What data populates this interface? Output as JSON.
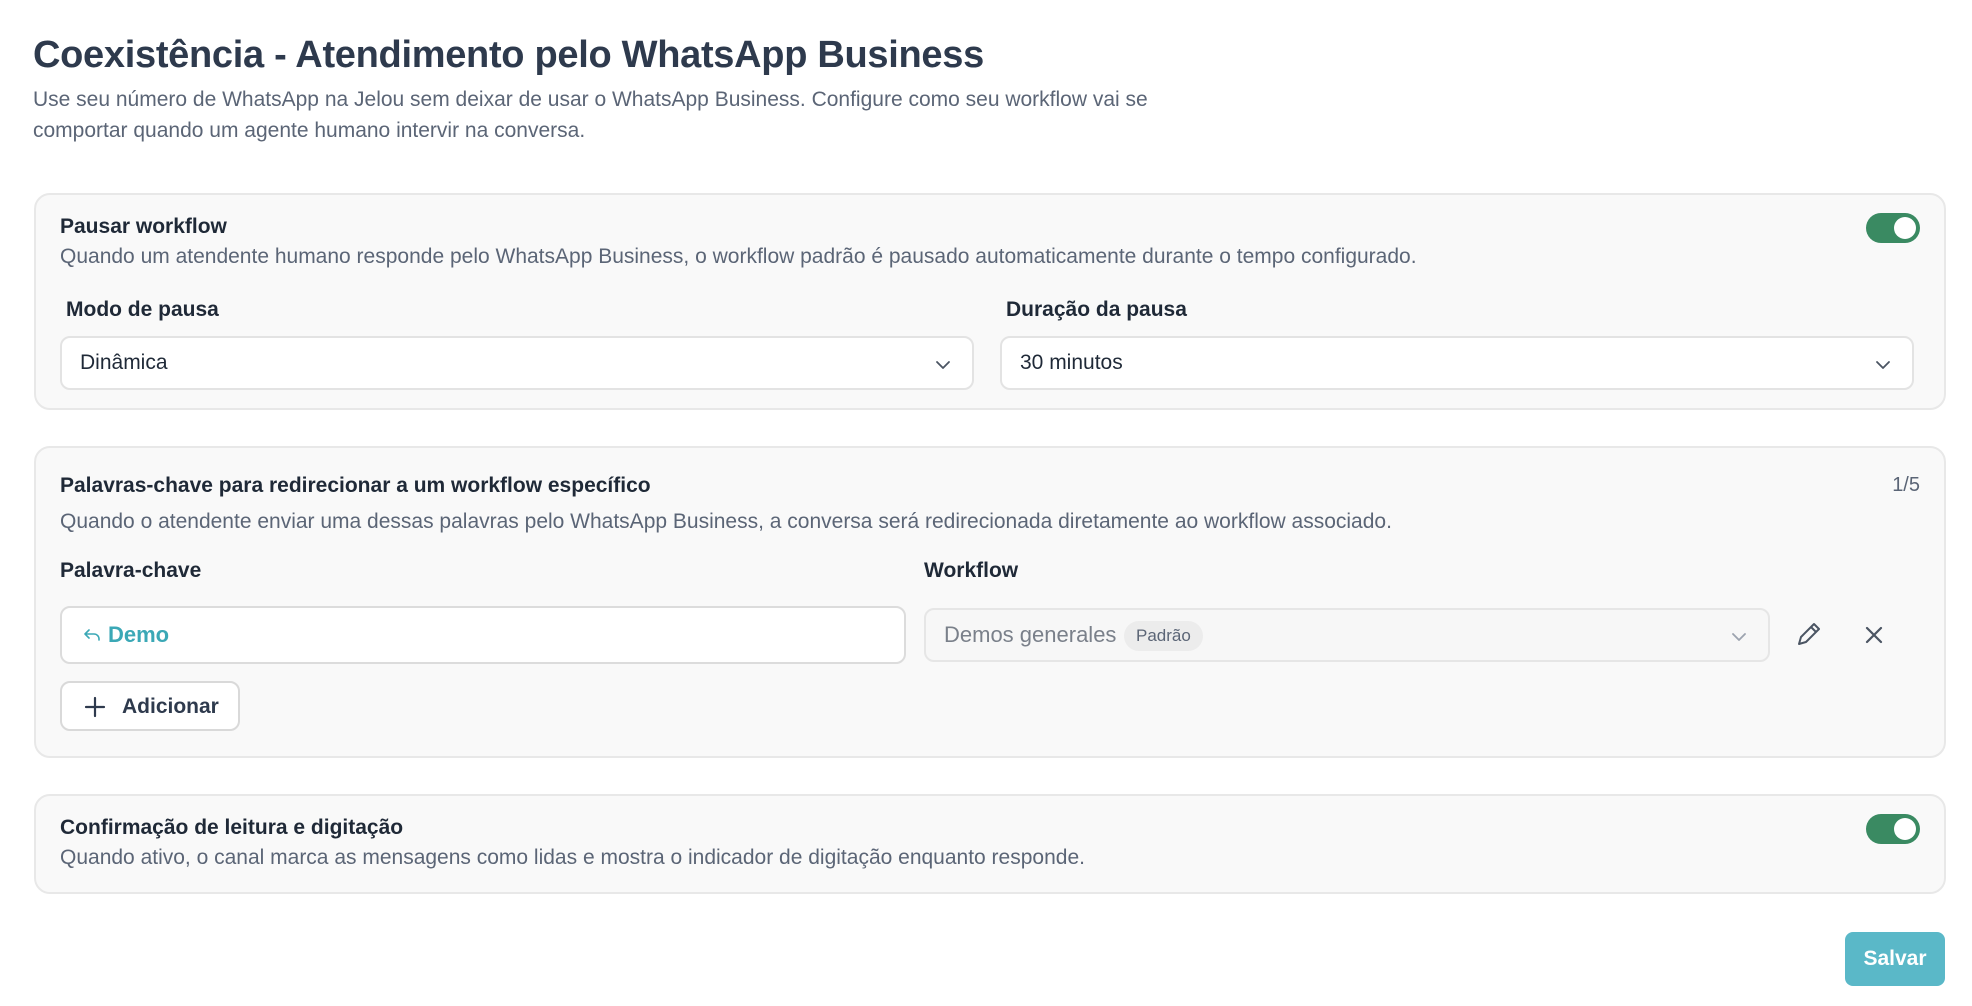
{
  "header": {
    "title": "Coexistência - Atendimento pelo WhatsApp Business",
    "description": "Use seu número de WhatsApp na Jelou sem deixar de usar o WhatsApp Business. Configure como seu workflow vai se comportar quando um agente humano intervir na conversa."
  },
  "pause_card": {
    "title": "Pausar workflow",
    "description": "Quando um atendente humano responde pelo WhatsApp Business, o workflow padrão é pausado automaticamente durante o tempo configurado.",
    "toggle_on": true,
    "mode_label": "Modo de pausa",
    "mode_value": "Dinâmica",
    "duration_label": "Duração da pausa",
    "duration_value": "30 minutos"
  },
  "keywords_card": {
    "title": "Palavras-chave para redirecionar a um workflow específico",
    "counter": "1/5",
    "description": "Quando o atendente enviar uma dessas palavras pelo WhatsApp Business, a conversa será redirecionada diretamente ao workflow associado.",
    "keyword_col": "Palavra-chave",
    "workflow_col": "Workflow",
    "rows": [
      {
        "keyword": "Demo",
        "workflow": "Demos generales",
        "badge": "Padrão"
      }
    ],
    "add_label": "Adicionar"
  },
  "read_card": {
    "title": "Confirmação de leitura e digitação",
    "description": "Quando ativo, o canal marca as mensagens como lidas e mostra o indicador de digitação enquanto responde.",
    "toggle_on": true
  },
  "footer": {
    "save_label": "Salvar"
  },
  "colors": {
    "toggle_on": "#3a8a62",
    "accent": "#3ba8b6",
    "save_button": "#5ab8c8"
  },
  "icons": {
    "select_chevron": "chevron-down-icon",
    "keyword": "reply-arrow-icon",
    "edit": "pencil-icon",
    "remove": "close-icon",
    "add": "plus-icon"
  }
}
